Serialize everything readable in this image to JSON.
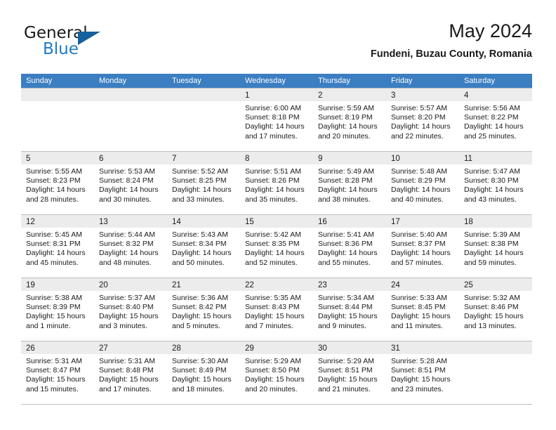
{
  "brand": {
    "line1": "General",
    "line2": "Blue",
    "triangle_color": "#14619e",
    "blue_text_color": "#1f7bc4"
  },
  "header": {
    "title": "May 2024",
    "subtitle": "Fundeni, Buzau County, Romania"
  },
  "theme": {
    "header_row_bg": "#3b7ec1",
    "daynum_band_bg": "#ececec",
    "grid_line": "#bfbfbf",
    "text": "#1a1a1a"
  },
  "labels": {
    "sunrise_prefix": "Sunrise:",
    "sunset_prefix": "Sunset:",
    "daylight_prefix": "Daylight:"
  },
  "dow": [
    "Sunday",
    "Monday",
    "Tuesday",
    "Wednesday",
    "Thursday",
    "Friday",
    "Saturday"
  ],
  "weeks": [
    [
      {
        "day": "",
        "sunrise": "",
        "sunset": "",
        "daylight1": "",
        "daylight2": ""
      },
      {
        "day": "",
        "sunrise": "",
        "sunset": "",
        "daylight1": "",
        "daylight2": ""
      },
      {
        "day": "",
        "sunrise": "",
        "sunset": "",
        "daylight1": "",
        "daylight2": ""
      },
      {
        "day": "1",
        "sunrise": "Sunrise: 6:00 AM",
        "sunset": "Sunset: 8:18 PM",
        "daylight1": "Daylight: 14 hours",
        "daylight2": "and 17 minutes."
      },
      {
        "day": "2",
        "sunrise": "Sunrise: 5:59 AM",
        "sunset": "Sunset: 8:19 PM",
        "daylight1": "Daylight: 14 hours",
        "daylight2": "and 20 minutes."
      },
      {
        "day": "3",
        "sunrise": "Sunrise: 5:57 AM",
        "sunset": "Sunset: 8:20 PM",
        "daylight1": "Daylight: 14 hours",
        "daylight2": "and 22 minutes."
      },
      {
        "day": "4",
        "sunrise": "Sunrise: 5:56 AM",
        "sunset": "Sunset: 8:22 PM",
        "daylight1": "Daylight: 14 hours",
        "daylight2": "and 25 minutes."
      }
    ],
    [
      {
        "day": "5",
        "sunrise": "Sunrise: 5:55 AM",
        "sunset": "Sunset: 8:23 PM",
        "daylight1": "Daylight: 14 hours",
        "daylight2": "and 28 minutes."
      },
      {
        "day": "6",
        "sunrise": "Sunrise: 5:53 AM",
        "sunset": "Sunset: 8:24 PM",
        "daylight1": "Daylight: 14 hours",
        "daylight2": "and 30 minutes."
      },
      {
        "day": "7",
        "sunrise": "Sunrise: 5:52 AM",
        "sunset": "Sunset: 8:25 PM",
        "daylight1": "Daylight: 14 hours",
        "daylight2": "and 33 minutes."
      },
      {
        "day": "8",
        "sunrise": "Sunrise: 5:51 AM",
        "sunset": "Sunset: 8:26 PM",
        "daylight1": "Daylight: 14 hours",
        "daylight2": "and 35 minutes."
      },
      {
        "day": "9",
        "sunrise": "Sunrise: 5:49 AM",
        "sunset": "Sunset: 8:28 PM",
        "daylight1": "Daylight: 14 hours",
        "daylight2": "and 38 minutes."
      },
      {
        "day": "10",
        "sunrise": "Sunrise: 5:48 AM",
        "sunset": "Sunset: 8:29 PM",
        "daylight1": "Daylight: 14 hours",
        "daylight2": "and 40 minutes."
      },
      {
        "day": "11",
        "sunrise": "Sunrise: 5:47 AM",
        "sunset": "Sunset: 8:30 PM",
        "daylight1": "Daylight: 14 hours",
        "daylight2": "and 43 minutes."
      }
    ],
    [
      {
        "day": "12",
        "sunrise": "Sunrise: 5:45 AM",
        "sunset": "Sunset: 8:31 PM",
        "daylight1": "Daylight: 14 hours",
        "daylight2": "and 45 minutes."
      },
      {
        "day": "13",
        "sunrise": "Sunrise: 5:44 AM",
        "sunset": "Sunset: 8:32 PM",
        "daylight1": "Daylight: 14 hours",
        "daylight2": "and 48 minutes."
      },
      {
        "day": "14",
        "sunrise": "Sunrise: 5:43 AM",
        "sunset": "Sunset: 8:34 PM",
        "daylight1": "Daylight: 14 hours",
        "daylight2": "and 50 minutes."
      },
      {
        "day": "15",
        "sunrise": "Sunrise: 5:42 AM",
        "sunset": "Sunset: 8:35 PM",
        "daylight1": "Daylight: 14 hours",
        "daylight2": "and 52 minutes."
      },
      {
        "day": "16",
        "sunrise": "Sunrise: 5:41 AM",
        "sunset": "Sunset: 8:36 PM",
        "daylight1": "Daylight: 14 hours",
        "daylight2": "and 55 minutes."
      },
      {
        "day": "17",
        "sunrise": "Sunrise: 5:40 AM",
        "sunset": "Sunset: 8:37 PM",
        "daylight1": "Daylight: 14 hours",
        "daylight2": "and 57 minutes."
      },
      {
        "day": "18",
        "sunrise": "Sunrise: 5:39 AM",
        "sunset": "Sunset: 8:38 PM",
        "daylight1": "Daylight: 14 hours",
        "daylight2": "and 59 minutes."
      }
    ],
    [
      {
        "day": "19",
        "sunrise": "Sunrise: 5:38 AM",
        "sunset": "Sunset: 8:39 PM",
        "daylight1": "Daylight: 15 hours",
        "daylight2": "and 1 minute."
      },
      {
        "day": "20",
        "sunrise": "Sunrise: 5:37 AM",
        "sunset": "Sunset: 8:40 PM",
        "daylight1": "Daylight: 15 hours",
        "daylight2": "and 3 minutes."
      },
      {
        "day": "21",
        "sunrise": "Sunrise: 5:36 AM",
        "sunset": "Sunset: 8:42 PM",
        "daylight1": "Daylight: 15 hours",
        "daylight2": "and 5 minutes."
      },
      {
        "day": "22",
        "sunrise": "Sunrise: 5:35 AM",
        "sunset": "Sunset: 8:43 PM",
        "daylight1": "Daylight: 15 hours",
        "daylight2": "and 7 minutes."
      },
      {
        "day": "23",
        "sunrise": "Sunrise: 5:34 AM",
        "sunset": "Sunset: 8:44 PM",
        "daylight1": "Daylight: 15 hours",
        "daylight2": "and 9 minutes."
      },
      {
        "day": "24",
        "sunrise": "Sunrise: 5:33 AM",
        "sunset": "Sunset: 8:45 PM",
        "daylight1": "Daylight: 15 hours",
        "daylight2": "and 11 minutes."
      },
      {
        "day": "25",
        "sunrise": "Sunrise: 5:32 AM",
        "sunset": "Sunset: 8:46 PM",
        "daylight1": "Daylight: 15 hours",
        "daylight2": "and 13 minutes."
      }
    ],
    [
      {
        "day": "26",
        "sunrise": "Sunrise: 5:31 AM",
        "sunset": "Sunset: 8:47 PM",
        "daylight1": "Daylight: 15 hours",
        "daylight2": "and 15 minutes."
      },
      {
        "day": "27",
        "sunrise": "Sunrise: 5:31 AM",
        "sunset": "Sunset: 8:48 PM",
        "daylight1": "Daylight: 15 hours",
        "daylight2": "and 17 minutes."
      },
      {
        "day": "28",
        "sunrise": "Sunrise: 5:30 AM",
        "sunset": "Sunset: 8:49 PM",
        "daylight1": "Daylight: 15 hours",
        "daylight2": "and 18 minutes."
      },
      {
        "day": "29",
        "sunrise": "Sunrise: 5:29 AM",
        "sunset": "Sunset: 8:50 PM",
        "daylight1": "Daylight: 15 hours",
        "daylight2": "and 20 minutes."
      },
      {
        "day": "30",
        "sunrise": "Sunrise: 5:29 AM",
        "sunset": "Sunset: 8:51 PM",
        "daylight1": "Daylight: 15 hours",
        "daylight2": "and 21 minutes."
      },
      {
        "day": "31",
        "sunrise": "Sunrise: 5:28 AM",
        "sunset": "Sunset: 8:51 PM",
        "daylight1": "Daylight: 15 hours",
        "daylight2": "and 23 minutes."
      },
      {
        "day": "",
        "sunrise": "",
        "sunset": "",
        "daylight1": "",
        "daylight2": ""
      }
    ]
  ]
}
